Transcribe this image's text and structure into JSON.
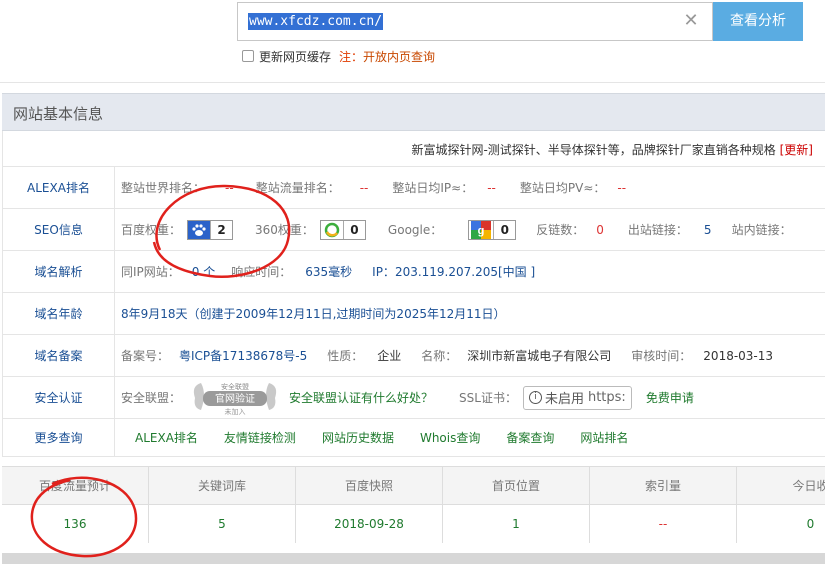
{
  "search": {
    "url": "www.xfcdz.com.cn/",
    "button_label": "查看分析",
    "checkbox_label": "更新网页缓存",
    "note_prefix": "注：",
    "note_link": "开放内页查询"
  },
  "panel": {
    "title": "网站基本信息",
    "description": "新富城探针网-测试探针、半导体探针等，品牌探针厂家直销各种规格",
    "update_label": "[更新]"
  },
  "alexa": {
    "label": "ALEXA排名",
    "world_rank_label": "整站世界排名：",
    "world_rank_value": "--",
    "traffic_rank_label": "整站流量排名：",
    "traffic_rank_value": "--",
    "daily_ip_label": "整站日均IP≈：",
    "daily_ip_value": "--",
    "daily_pv_label": "整站日均PV≈：",
    "daily_pv_value": "--"
  },
  "seo": {
    "label": "SEO信息",
    "baidu_label": "百度权重：",
    "baidu_value": "2",
    "s360_label": "360权重：",
    "s360_value": "0",
    "google_label": "Google：",
    "google_value": "0",
    "backlinks_label": "反链数：",
    "backlinks_value": "0",
    "outlinks_label": "出站链接：",
    "outlinks_value": "5",
    "inlinks_label": "站内链接："
  },
  "dns": {
    "label": "域名解析",
    "same_ip_label": "同IP网站：",
    "same_ip_value": "0 个",
    "response_label": "响应时间：",
    "response_value": "635毫秒",
    "ip_label": "IP：",
    "ip_value": "203.119.207.205[中国 ]"
  },
  "age": {
    "label": "域名年龄",
    "value": "8年9月18天（创建于2009年12月11日,过期时间为2025年12月11日）"
  },
  "icp": {
    "label": "域名备案",
    "number_label": "备案号：",
    "number_value": "粤ICP备17138678号-5",
    "nature_label": "性质：",
    "nature_value": "企业",
    "name_label": "名称：",
    "name_value": "深圳市新富城电子有限公司",
    "time_label": "审核时间：",
    "time_value": "2018-03-13"
  },
  "security": {
    "label": "安全认证",
    "alliance_label": "安全联盟：",
    "seal_top": "安全联盟",
    "seal_main": "官网验证",
    "seal_bottom": "未加入",
    "alliance_link": "安全联盟认证有什么好处？",
    "ssl_label": "SSL证书：",
    "ssl_status": "未启用",
    "ssl_https": "https:",
    "ssl_apply": "免费申请"
  },
  "more": {
    "label": "更多查询",
    "links": [
      "ALEXA排名",
      "友情链接检测",
      "网站历史数据",
      "Whois查询",
      "备案查询",
      "网站排名"
    ]
  },
  "stats": {
    "headers": [
      "百度流量预计",
      "关键词库",
      "百度快照",
      "首页位置",
      "索引量",
      "今日收"
    ],
    "values": [
      "136",
      "5",
      "2018-09-28",
      "1",
      "--",
      "0"
    ]
  },
  "colors": {
    "accent_button": "#5aace2",
    "link_blue": "#1a4f94",
    "value_red": "#d33",
    "link_green": "#1f7a2e",
    "annotation_red": "#e0211c"
  }
}
